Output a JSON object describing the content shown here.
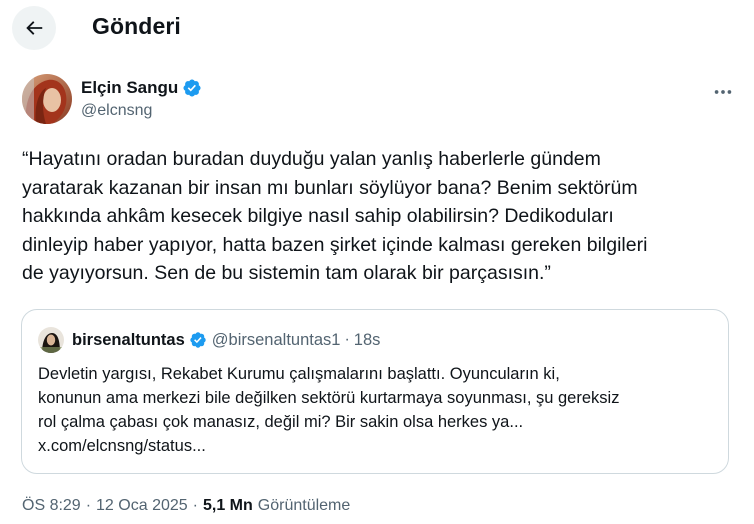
{
  "header": {
    "title": "Gönderi"
  },
  "tweet": {
    "author": {
      "name": "Elçin Sangu",
      "handle": "@elcnsng",
      "verified": true
    },
    "text": "“Hayatını oradan buradan duyduğu yalan yanlış haberlerle gündem\nyaratarak kazanan bir insan mı bunları söylüyor bana? Benim sektörüm\nhakkında ahkâm kesecek bilgiye nasıl sahip olabilirsin? Dedikoduları\ndinleyip haber yapıyor, hatta bazen şirket içinde kalması gereken bilgileri\nde yayıyorsun. Sen de bu sistemin tam olarak bir parçasısın.”",
    "quote": {
      "name": "birsenaltuntas",
      "handle": "@birsenaltuntas1",
      "dot": "·",
      "time": "18s",
      "text": "Devletin yargısı, Rekabet Kurumu çalışmalarını başlattı. Oyuncuların ki,\nkonunun ama merkezi bile değilken sektörü kurtarmaya soyunması, şu gereksiz\nrol çalma çabası çok manasız, değil mi? Bir sakin olsa herkes ya...\nx.com/elcnsng/status..."
    },
    "meta": {
      "time": "ÖS 8:29",
      "sep1": "·",
      "date": "12 Oca 2025",
      "sep2": "·",
      "views_count": "5,1 Mn",
      "views_label": "Görüntüleme"
    }
  },
  "colors": {
    "accent": "#1d9bf0",
    "text_primary": "#0f1419",
    "text_secondary": "#536471",
    "border": "#cfd9de",
    "back_button_bg": "#eff3f4"
  },
  "icons": {
    "back": "arrow-left-icon",
    "verified": "verified-badge-icon",
    "more": "more-horizontal-icon"
  }
}
